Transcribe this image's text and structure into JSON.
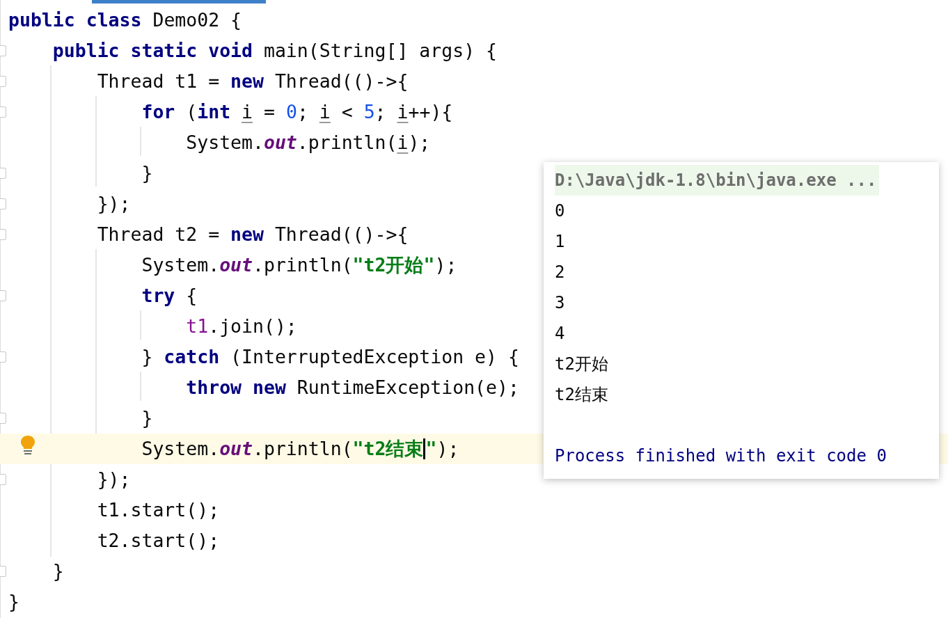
{
  "editor": {
    "lines": [
      {
        "fold": false,
        "highlighted": false,
        "bulb": false,
        "tokens": [
          {
            "kind": "keyword",
            "text": "public class "
          },
          {
            "kind": "plain",
            "text": "Demo02 {"
          }
        ]
      },
      {
        "fold": true,
        "highlighted": false,
        "bulb": false,
        "tokens": [
          {
            "kind": "keyword",
            "text": "    public static void "
          },
          {
            "kind": "plain",
            "text": "main(String[] args) {"
          }
        ]
      },
      {
        "fold": true,
        "highlighted": false,
        "bulb": false,
        "tokens": [
          {
            "kind": "plain",
            "text": "        Thread t1 = "
          },
          {
            "kind": "keyword",
            "text": "new "
          },
          {
            "kind": "plain",
            "text": "Thread(()->{"
          }
        ]
      },
      {
        "fold": true,
        "highlighted": false,
        "bulb": false,
        "tokens": [
          {
            "kind": "keyword",
            "text": "            for "
          },
          {
            "kind": "plain",
            "text": "("
          },
          {
            "kind": "keyword",
            "text": "int "
          },
          {
            "kind": "local",
            "text": "i"
          },
          {
            "kind": "plain",
            "text": " = "
          },
          {
            "kind": "number",
            "text": "0"
          },
          {
            "kind": "plain",
            "text": "; "
          },
          {
            "kind": "local",
            "text": "i"
          },
          {
            "kind": "plain",
            "text": " < "
          },
          {
            "kind": "number",
            "text": "5"
          },
          {
            "kind": "plain",
            "text": "; "
          },
          {
            "kind": "local",
            "text": "i"
          },
          {
            "kind": "plain",
            "text": "++){"
          }
        ]
      },
      {
        "fold": false,
        "highlighted": false,
        "bulb": false,
        "tokens": [
          {
            "kind": "plain",
            "text": "                System."
          },
          {
            "kind": "field",
            "text": "out"
          },
          {
            "kind": "plain",
            "text": ".println("
          },
          {
            "kind": "local",
            "text": "i"
          },
          {
            "kind": "plain",
            "text": ");"
          }
        ]
      },
      {
        "fold": true,
        "highlighted": false,
        "bulb": false,
        "tokens": [
          {
            "kind": "plain",
            "text": "            }"
          }
        ]
      },
      {
        "fold": true,
        "highlighted": false,
        "bulb": false,
        "tokens": [
          {
            "kind": "plain",
            "text": "        });"
          }
        ]
      },
      {
        "fold": true,
        "highlighted": false,
        "bulb": false,
        "tokens": [
          {
            "kind": "plain",
            "text": "        Thread t2 = "
          },
          {
            "kind": "keyword",
            "text": "new "
          },
          {
            "kind": "plain",
            "text": "Thread(()->{"
          }
        ]
      },
      {
        "fold": false,
        "highlighted": false,
        "bulb": false,
        "tokens": [
          {
            "kind": "plain",
            "text": "            System."
          },
          {
            "kind": "field",
            "text": "out"
          },
          {
            "kind": "plain",
            "text": ".println("
          },
          {
            "kind": "string",
            "text": "\"t2开始\""
          },
          {
            "kind": "plain",
            "text": ");"
          }
        ]
      },
      {
        "fold": true,
        "highlighted": false,
        "bulb": false,
        "tokens": [
          {
            "kind": "keyword",
            "text": "            try "
          },
          {
            "kind": "plain",
            "text": "{"
          }
        ]
      },
      {
        "fold": false,
        "highlighted": false,
        "bulb": false,
        "tokens": [
          {
            "kind": "captured",
            "text": "                t1"
          },
          {
            "kind": "plain",
            "text": ".join();"
          }
        ]
      },
      {
        "fold": true,
        "highlighted": false,
        "bulb": false,
        "tokens": [
          {
            "kind": "plain",
            "text": "            } "
          },
          {
            "kind": "keyword",
            "text": "catch "
          },
          {
            "kind": "plain",
            "text": "(InterruptedException e) {"
          }
        ]
      },
      {
        "fold": false,
        "highlighted": false,
        "bulb": false,
        "tokens": [
          {
            "kind": "keyword",
            "text": "                throw new "
          },
          {
            "kind": "plain",
            "text": "RuntimeException(e);"
          }
        ]
      },
      {
        "fold": true,
        "highlighted": false,
        "bulb": false,
        "tokens": [
          {
            "kind": "plain",
            "text": "            }"
          }
        ]
      },
      {
        "fold": false,
        "highlighted": true,
        "bulb": true,
        "tokens": [
          {
            "kind": "plain",
            "text": "            System."
          },
          {
            "kind": "field",
            "text": "out"
          },
          {
            "kind": "plain",
            "text": ".println("
          },
          {
            "kind": "string",
            "text": "\"t2结束"
          },
          {
            "kind": "caret"
          },
          {
            "kind": "string",
            "text": "\""
          },
          {
            "kind": "plain",
            "text": ");"
          }
        ]
      },
      {
        "fold": true,
        "highlighted": false,
        "bulb": false,
        "tokens": [
          {
            "kind": "plain",
            "text": "        });"
          }
        ]
      },
      {
        "fold": false,
        "highlighted": false,
        "bulb": false,
        "tokens": [
          {
            "kind": "plain",
            "text": "        t1.start();"
          }
        ]
      },
      {
        "fold": false,
        "highlighted": false,
        "bulb": false,
        "tokens": [
          {
            "kind": "plain",
            "text": "        t2.start();"
          }
        ]
      },
      {
        "fold": true,
        "highlighted": false,
        "bulb": false,
        "tokens": [
          {
            "kind": "plain",
            "text": "    }"
          }
        ]
      },
      {
        "fold": false,
        "highlighted": false,
        "bulb": false,
        "tokens": [
          {
            "kind": "plain",
            "text": "}"
          }
        ]
      }
    ]
  },
  "output_popup": {
    "lines": [
      {
        "kind": "command",
        "text": "D:\\Java\\jdk-1.8\\bin\\java.exe ..."
      },
      {
        "kind": "stdout",
        "text": "0"
      },
      {
        "kind": "stdout",
        "text": "1"
      },
      {
        "kind": "stdout",
        "text": "2"
      },
      {
        "kind": "stdout",
        "text": "3"
      },
      {
        "kind": "stdout",
        "text": "4"
      },
      {
        "kind": "stdout",
        "text": "t2开始"
      },
      {
        "kind": "stdout",
        "text": "t2结束"
      },
      {
        "kind": "exit",
        "text": "Process finished with exit code 0"
      }
    ]
  }
}
